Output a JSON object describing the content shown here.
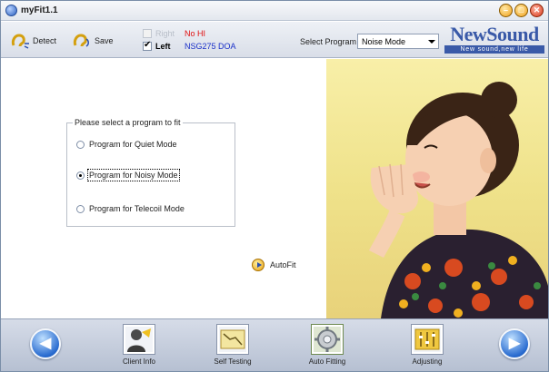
{
  "window": {
    "title": "myFit1.1"
  },
  "toolbar": {
    "detect_label": "Detect",
    "save_label": "Save",
    "right_ear": {
      "label": "Right",
      "checked": false,
      "enabled": false,
      "device": "No HI",
      "device_color": "#e01010"
    },
    "left_ear": {
      "label": "Left",
      "checked": true,
      "enabled": true,
      "device": "NSG275 DOA",
      "device_color": "#1a30c8"
    },
    "select_program_label": "Select Program",
    "select_program_value": "Noise Mode"
  },
  "logo": {
    "main": "NewSound",
    "tagline": "New sound,new life",
    "color": "#3a5aa8"
  },
  "program_group": {
    "title": "Please select a program to fit",
    "options": [
      {
        "label": "Program for Quiet Mode",
        "selected": false
      },
      {
        "label": "Program for Noisy Mode",
        "selected": true
      },
      {
        "label": "Program for Telecoil Mode",
        "selected": false
      }
    ]
  },
  "autofit_label": "AutoFit",
  "bottom_nav": {
    "prev_icon": "arrow-left-icon",
    "next_icon": "arrow-right-icon",
    "steps": [
      {
        "label": "Client Info",
        "icon": "client-info-icon"
      },
      {
        "label": "Self Testing",
        "icon": "self-testing-icon"
      },
      {
        "label": "Auto Fitting",
        "icon": "auto-fitting-icon",
        "active": true
      },
      {
        "label": "Adjusting",
        "icon": "adjusting-icon"
      }
    ]
  }
}
